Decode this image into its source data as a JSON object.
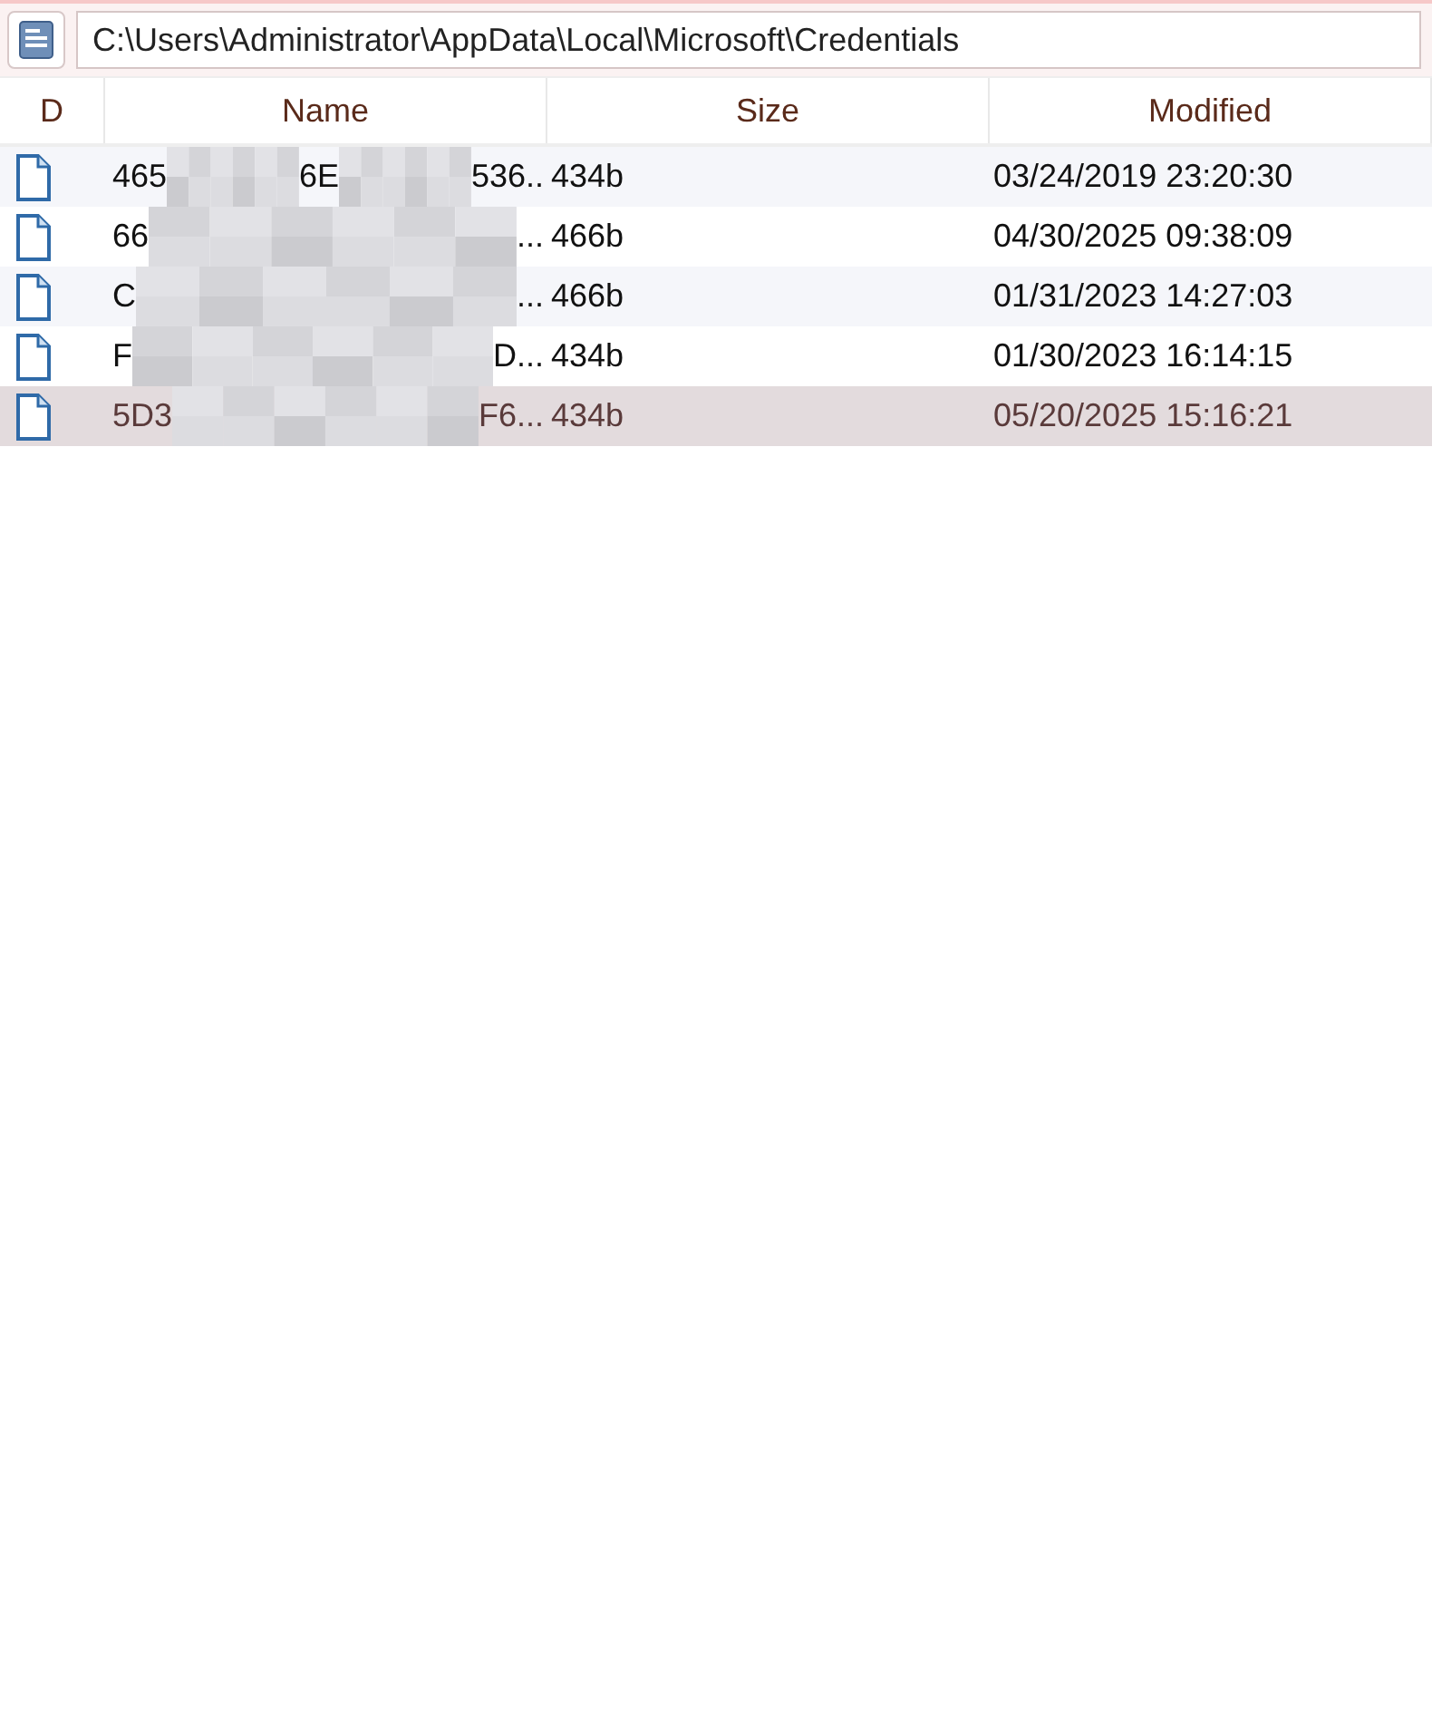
{
  "path_field": {
    "value": "C:\\Users\\Administrator\\AppData\\Local\\Microsoft\\Credentials"
  },
  "table": {
    "columns": [
      "D",
      "Name",
      "Size",
      "Modified"
    ],
    "rows": [
      {
        "name_fragments": [
          "465",
          "6E",
          "536.."
        ],
        "size": "434b",
        "modified": "03/24/2019 23:20:30",
        "selected": false
      },
      {
        "name_fragments": [
          "66",
          "..."
        ],
        "size": "466b",
        "modified": "04/30/2025 09:38:09",
        "selected": false
      },
      {
        "name_fragments": [
          "C",
          "..."
        ],
        "size": "466b",
        "modified": "01/31/2023 14:27:03",
        "selected": false
      },
      {
        "name_fragments": [
          "F",
          "D..."
        ],
        "size": "434b",
        "modified": "01/30/2023 16:14:15",
        "selected": false
      },
      {
        "name_fragments": [
          "5D3",
          "F6..."
        ],
        "size": "434b",
        "modified": "05/20/2025 15:16:21",
        "selected": true
      }
    ]
  }
}
